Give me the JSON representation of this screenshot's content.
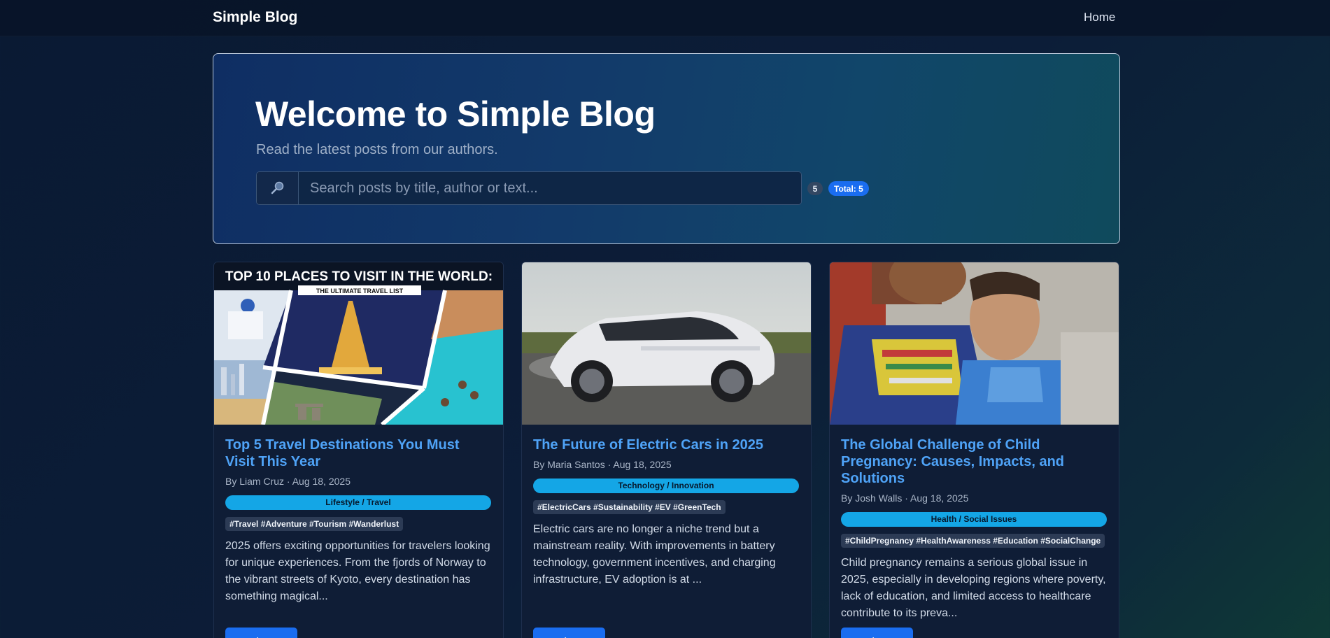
{
  "navbar": {
    "brand": "Simple Blog",
    "links": [
      "Home"
    ]
  },
  "hero": {
    "title": "Welcome to Simple Blog",
    "subtitle": "Read the latest posts from our authors.",
    "search": {
      "placeholder": "Search posts by title, author or text...",
      "value": ""
    },
    "count_badge": "5",
    "total_badge": "Total: 5"
  },
  "posts": [
    {
      "image_icon": "travel-collage-image",
      "image_text": {
        "headline": "TOP 10 PLACES TO VISIT IN THE WORLD:",
        "subline": "THE ULTIMATE TRAVEL LIST"
      },
      "title": "Top 5 Travel Destinations You Must Visit This Year",
      "meta": "By Liam Cruz · Aug 18, 2025",
      "category": "Lifestyle / Travel",
      "tags": "#Travel #Adventure #Tourism #Wanderlust",
      "excerpt": "2025 offers exciting opportunities for travelers looking for unique experiences. From the fjords of Norway to the vibrant streets of Kyoto, every destination has something magical...",
      "button": "Read More"
    },
    {
      "image_icon": "electric-car-image",
      "title": "The Future of Electric Cars in 2025",
      "meta": "By Maria Santos · Aug 18, 2025",
      "category": "Technology / Innovation",
      "tags": "#ElectricCars #Sustainability #EV #GreenTech",
      "excerpt": "Electric cars are no longer a niche trend but a mainstream reality. With improvements in battery technology, government incentives, and charging infrastructure, EV adoption is at ...",
      "button": "Read More"
    },
    {
      "image_icon": "mother-and-child-image",
      "title": "The Global Challenge of Child Pregnancy: Causes, Impacts, and Solutions",
      "meta": "By Josh Walls · Aug 18, 2025",
      "category": "Health / Social Issues",
      "tags": "#ChildPregnancy #HealthAwareness #Education #SocialChange",
      "excerpt": "Child pregnancy remains a serious global issue in 2025, especially in developing regions where poverty, lack of education, and limited access to healthcare contribute to its preva...",
      "button": "Read More"
    }
  ]
}
